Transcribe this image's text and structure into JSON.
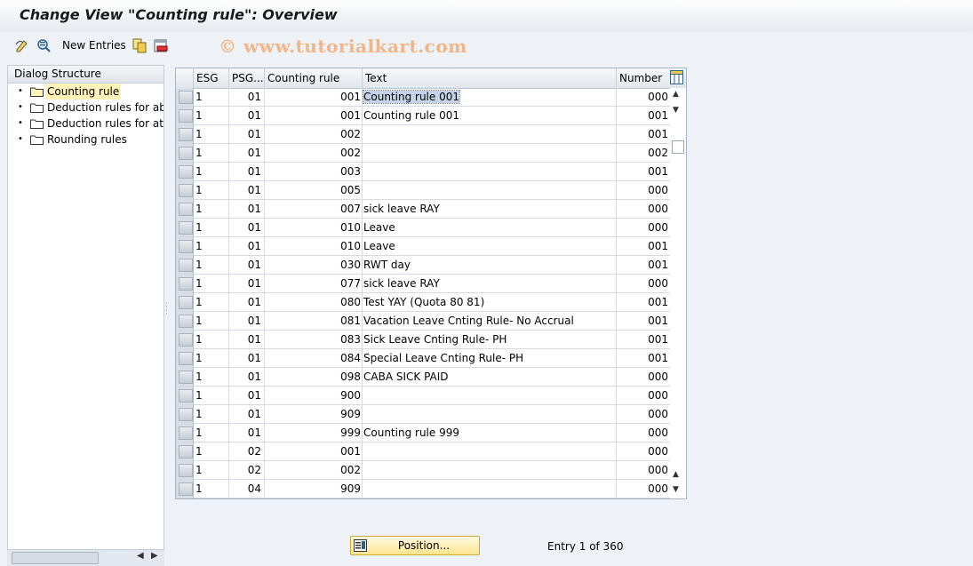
{
  "window": {
    "title": "Change View \"Counting rule\": Overview",
    "watermark": "© www.tutorialkart.com"
  },
  "toolbar": {
    "new_entries_label": "New Entries",
    "icons": [
      "edit-display-icon",
      "details-icon",
      "new-entries",
      "copy-icon",
      "delete-icon"
    ]
  },
  "dialog_structure": {
    "header": "Dialog Structure",
    "items": [
      {
        "label": "Counting rule",
        "selected": true
      },
      {
        "label": "Deduction rules for abse",
        "selected": false
      },
      {
        "label": "Deduction rules for atter",
        "selected": false
      },
      {
        "label": "Rounding rules",
        "selected": false
      }
    ]
  },
  "table": {
    "columns": {
      "esg": "ESG",
      "psg": "PSG...",
      "rule": "Counting rule",
      "text": "Text",
      "number": "Number"
    },
    "rows": [
      {
        "esg": "1",
        "psg": "01",
        "rule": "001",
        "text": "Counting rule 001",
        "number": "000"
      },
      {
        "esg": "1",
        "psg": "01",
        "rule": "001",
        "text": "Counting rule 001",
        "number": "001"
      },
      {
        "esg": "1",
        "psg": "01",
        "rule": "002",
        "text": "",
        "number": "001"
      },
      {
        "esg": "1",
        "psg": "01",
        "rule": "002",
        "text": "",
        "number": "002"
      },
      {
        "esg": "1",
        "psg": "01",
        "rule": "003",
        "text": "",
        "number": "001"
      },
      {
        "esg": "1",
        "psg": "01",
        "rule": "005",
        "text": "",
        "number": "000"
      },
      {
        "esg": "1",
        "psg": "01",
        "rule": "007",
        "text": "sick leave RAY",
        "number": "000"
      },
      {
        "esg": "1",
        "psg": "01",
        "rule": "010",
        "text": "Leave",
        "number": "000"
      },
      {
        "esg": "1",
        "psg": "01",
        "rule": "010",
        "text": "Leave",
        "number": "001"
      },
      {
        "esg": "1",
        "psg": "01",
        "rule": "030",
        "text": "RWT day",
        "number": "001"
      },
      {
        "esg": "1",
        "psg": "01",
        "rule": "077",
        "text": "sick leave RAY",
        "number": "000"
      },
      {
        "esg": "1",
        "psg": "01",
        "rule": "080",
        "text": "Test YAY (Quota 80 81)",
        "number": "001"
      },
      {
        "esg": "1",
        "psg": "01",
        "rule": "081",
        "text": "Vacation Leave Cnting Rule- No Accrual",
        "number": "001"
      },
      {
        "esg": "1",
        "psg": "01",
        "rule": "083",
        "text": "Sick Leave Cnting Rule- PH",
        "number": "001"
      },
      {
        "esg": "1",
        "psg": "01",
        "rule": "084",
        "text": "Special Leave Cnting Rule- PH",
        "number": "001"
      },
      {
        "esg": "1",
        "psg": "01",
        "rule": "098",
        "text": "CABA SICK PAID",
        "number": "000"
      },
      {
        "esg": "1",
        "psg": "01",
        "rule": "900",
        "text": "",
        "number": "000"
      },
      {
        "esg": "1",
        "psg": "01",
        "rule": "909",
        "text": "",
        "number": "000"
      },
      {
        "esg": "1",
        "psg": "01",
        "rule": "999",
        "text": "Counting rule 999",
        "number": "000"
      },
      {
        "esg": "1",
        "psg": "02",
        "rule": "001",
        "text": "",
        "number": "000"
      },
      {
        "esg": "1",
        "psg": "02",
        "rule": "002",
        "text": "",
        "number": "000"
      },
      {
        "esg": "1",
        "psg": "04",
        "rule": "909",
        "text": "",
        "number": "000"
      }
    ]
  },
  "footer": {
    "position_button": "Position...",
    "entry_info": "Entry 1 of 360"
  }
}
